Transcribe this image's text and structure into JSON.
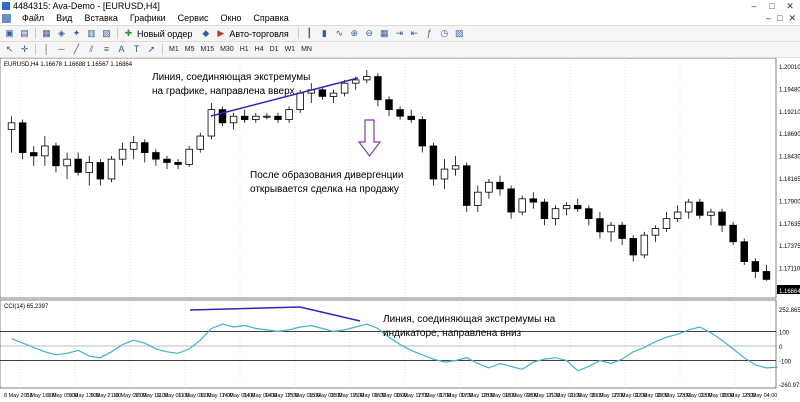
{
  "window": {
    "title": "4484315: Ava-Demo - [EURUSD,H4]",
    "controls": [
      "–",
      "□",
      "✕"
    ]
  },
  "menu": {
    "items": [
      "Файл",
      "Вид",
      "Вставка",
      "Графики",
      "Сервис",
      "Окно",
      "Справка"
    ],
    "right_controls": [
      "–",
      "□",
      "✕"
    ]
  },
  "toolbar": {
    "new_order_label": "Новый ордер",
    "auto_trading_label": "Авто-торговля"
  },
  "timeframes": [
    "M1",
    "M5",
    "M15",
    "M30",
    "H1",
    "H4",
    "D1",
    "W1",
    "MN"
  ],
  "chart_header": "EURUSD,H4  1.16678 1.16688 1.16567 1.16864",
  "indicator_header": "CCI(14) 65.2397",
  "price_labels": [
    "1.20010",
    "1.19480",
    "1.19210",
    "1.18690",
    "1.18430",
    "1.18165",
    "1.17900",
    "1.17635",
    "1.17375",
    "1.17110",
    "1.16864"
  ],
  "current_price": "1.16864",
  "cci_labels": [
    "252.8652",
    "100",
    "0",
    "-100",
    "-260.9727"
  ],
  "time_labels": [
    "8 May 2018",
    "8 May 16:00",
    "9 May 05:00",
    "9 May 13:00",
    "9 May 21:00",
    "10 May 09:00",
    "10 May 16:00",
    "11 May 01:00",
    "11 May 09:00",
    "11 May 17:00",
    "14 May 01:00",
    "14 May 09:00",
    "14 May 17:00",
    "15 May 01:00",
    "15 May 09:00",
    "15 May 17:00",
    "16 May 01:00",
    "16 May 09:00",
    "16 May 17:00",
    "17 May 01:00",
    "17 May 09:00",
    "17 May 17:00",
    "18 May 01:00",
    "18 May 09:00",
    "18 May 17:00",
    "21 May 01:00",
    "21 May 09:00",
    "21 May 17:00",
    "22 May 01:00",
    "22 May 09:00",
    "22 May 17:00",
    "23 May 01:00",
    "23 May 09:00",
    "23 May 17:00",
    "23 May 04:00"
  ],
  "annotations": {
    "price_line": "Линия, соединяющая экстремумы на графике, направлена вверх",
    "divergence": "После образования дивергенции открывается сделка на продажу",
    "indicator_line": "Линия, соединяющая экстремумы на индикаторе, направлена вниз"
  },
  "colors": {
    "bull": "#ffffff",
    "bear": "#000000",
    "cci": "#3fb3c6",
    "trend": "#2a2ab8",
    "arrow": "#8a3aa8"
  },
  "chart_data": {
    "type": "candlestick",
    "symbol": "EURUSD",
    "timeframe": "H4",
    "ylim": [
      1.1675,
      1.2008
    ],
    "candles": [
      [
        1.1915,
        1.1935,
        1.188,
        1.1925
      ],
      [
        1.1925,
        1.193,
        1.187,
        1.188
      ],
      [
        1.188,
        1.189,
        1.186,
        1.1875
      ],
      [
        1.1875,
        1.1905,
        1.186,
        1.189
      ],
      [
        1.189,
        1.1895,
        1.185,
        1.186
      ],
      [
        1.186,
        1.188,
        1.184,
        1.187
      ],
      [
        1.187,
        1.188,
        1.1845,
        1.185
      ],
      [
        1.185,
        1.1875,
        1.183,
        1.1865
      ],
      [
        1.1865,
        1.187,
        1.183,
        1.184
      ],
      [
        1.184,
        1.1875,
        1.1835,
        1.187
      ],
      [
        1.187,
        1.1895,
        1.186,
        1.1885
      ],
      [
        1.1885,
        1.1905,
        1.187,
        1.1895
      ],
      [
        1.1895,
        1.19,
        1.1865,
        1.188
      ],
      [
        1.188,
        1.1885,
        1.186,
        1.187
      ],
      [
        1.187,
        1.1875,
        1.1855,
        1.1865
      ],
      [
        1.1865,
        1.187,
        1.1855,
        1.1862
      ],
      [
        1.1862,
        1.189,
        1.1858,
        1.1885
      ],
      [
        1.1885,
        1.191,
        1.188,
        1.1905
      ],
      [
        1.1905,
        1.1955,
        1.19,
        1.1945
      ],
      [
        1.1945,
        1.195,
        1.192,
        1.1925
      ],
      [
        1.1925,
        1.194,
        1.1915,
        1.1935
      ],
      [
        1.1935,
        1.1945,
        1.1925,
        1.193
      ],
      [
        1.193,
        1.194,
        1.1925,
        1.1935
      ],
      [
        1.1935,
        1.194,
        1.193,
        1.1935
      ],
      [
        1.1935,
        1.194,
        1.1925,
        1.193
      ],
      [
        1.193,
        1.195,
        1.1925,
        1.1945
      ],
      [
        1.1945,
        1.1975,
        1.194,
        1.197
      ],
      [
        1.197,
        1.1985,
        1.1955,
        1.1975
      ],
      [
        1.1975,
        1.198,
        1.196,
        1.1965
      ],
      [
        1.1965,
        1.1975,
        1.1955,
        1.197
      ],
      [
        1.197,
        1.199,
        1.1965,
        1.1985
      ],
      [
        1.1985,
        1.1995,
        1.1975,
        1.199
      ],
      [
        1.199,
        1.2005,
        1.1985,
        1.1995
      ],
      [
        1.1995,
        1.2,
        1.195,
        1.196
      ],
      [
        1.196,
        1.1965,
        1.1935,
        1.1945
      ],
      [
        1.1945,
        1.195,
        1.193,
        1.1935
      ],
      [
        1.1935,
        1.1945,
        1.1925,
        1.193
      ],
      [
        1.193,
        1.1935,
        1.188,
        1.189
      ],
      [
        1.189,
        1.1895,
        1.183,
        1.184
      ],
      [
        1.184,
        1.187,
        1.1825,
        1.1855
      ],
      [
        1.1855,
        1.1875,
        1.1845,
        1.186
      ],
      [
        1.186,
        1.1865,
        1.179,
        1.18
      ],
      [
        1.18,
        1.183,
        1.179,
        1.182
      ],
      [
        1.182,
        1.184,
        1.181,
        1.1835
      ],
      [
        1.1835,
        1.1845,
        1.1815,
        1.1825
      ],
      [
        1.1825,
        1.183,
        1.178,
        1.179
      ],
      [
        1.179,
        1.1815,
        1.1785,
        1.181
      ],
      [
        1.181,
        1.182,
        1.1795,
        1.1805
      ],
      [
        1.1805,
        1.181,
        1.177,
        1.178
      ],
      [
        1.178,
        1.18,
        1.177,
        1.1795
      ],
      [
        1.1795,
        1.1805,
        1.1785,
        1.18
      ],
      [
        1.18,
        1.181,
        1.179,
        1.1795
      ],
      [
        1.1795,
        1.18,
        1.177,
        1.178
      ],
      [
        1.178,
        1.179,
        1.175,
        1.176
      ],
      [
        1.176,
        1.1775,
        1.1745,
        1.177
      ],
      [
        1.177,
        1.1775,
        1.174,
        1.175
      ],
      [
        1.175,
        1.1755,
        1.1715,
        1.1725
      ],
      [
        1.1725,
        1.176,
        1.172,
        1.1755
      ],
      [
        1.1755,
        1.177,
        1.1745,
        1.1765
      ],
      [
        1.1765,
        1.179,
        1.176,
        1.178
      ],
      [
        1.178,
        1.18,
        1.1775,
        1.179
      ],
      [
        1.179,
        1.181,
        1.178,
        1.1805
      ],
      [
        1.1805,
        1.181,
        1.178,
        1.1785
      ],
      [
        1.1785,
        1.1795,
        1.177,
        1.179
      ],
      [
        1.179,
        1.1795,
        1.176,
        1.177
      ],
      [
        1.177,
        1.1775,
        1.174,
        1.1745
      ],
      [
        1.1745,
        1.175,
        1.171,
        1.1715
      ],
      [
        1.1715,
        1.172,
        1.169,
        1.17
      ],
      [
        1.17,
        1.171,
        1.1686,
        1.1688
      ]
    ],
    "cci_values": [
      50,
      20,
      -10,
      -40,
      -60,
      -50,
      -30,
      -70,
      -80,
      -40,
      10,
      40,
      20,
      -20,
      -40,
      -50,
      -20,
      40,
      120,
      150,
      130,
      140,
      120,
      110,
      100,
      110,
      130,
      140,
      120,
      100,
      110,
      130,
      150,
      120,
      60,
      10,
      -30,
      -60,
      -90,
      -110,
      -100,
      -80,
      -120,
      -150,
      -120,
      -140,
      -160,
      -110,
      -90,
      -80,
      -100,
      -170,
      -140,
      -100,
      -120,
      -90,
      -40,
      -10,
      30,
      60,
      80,
      110,
      130,
      90,
      40,
      -20,
      -80,
      -130,
      -150,
      -145
    ]
  }
}
